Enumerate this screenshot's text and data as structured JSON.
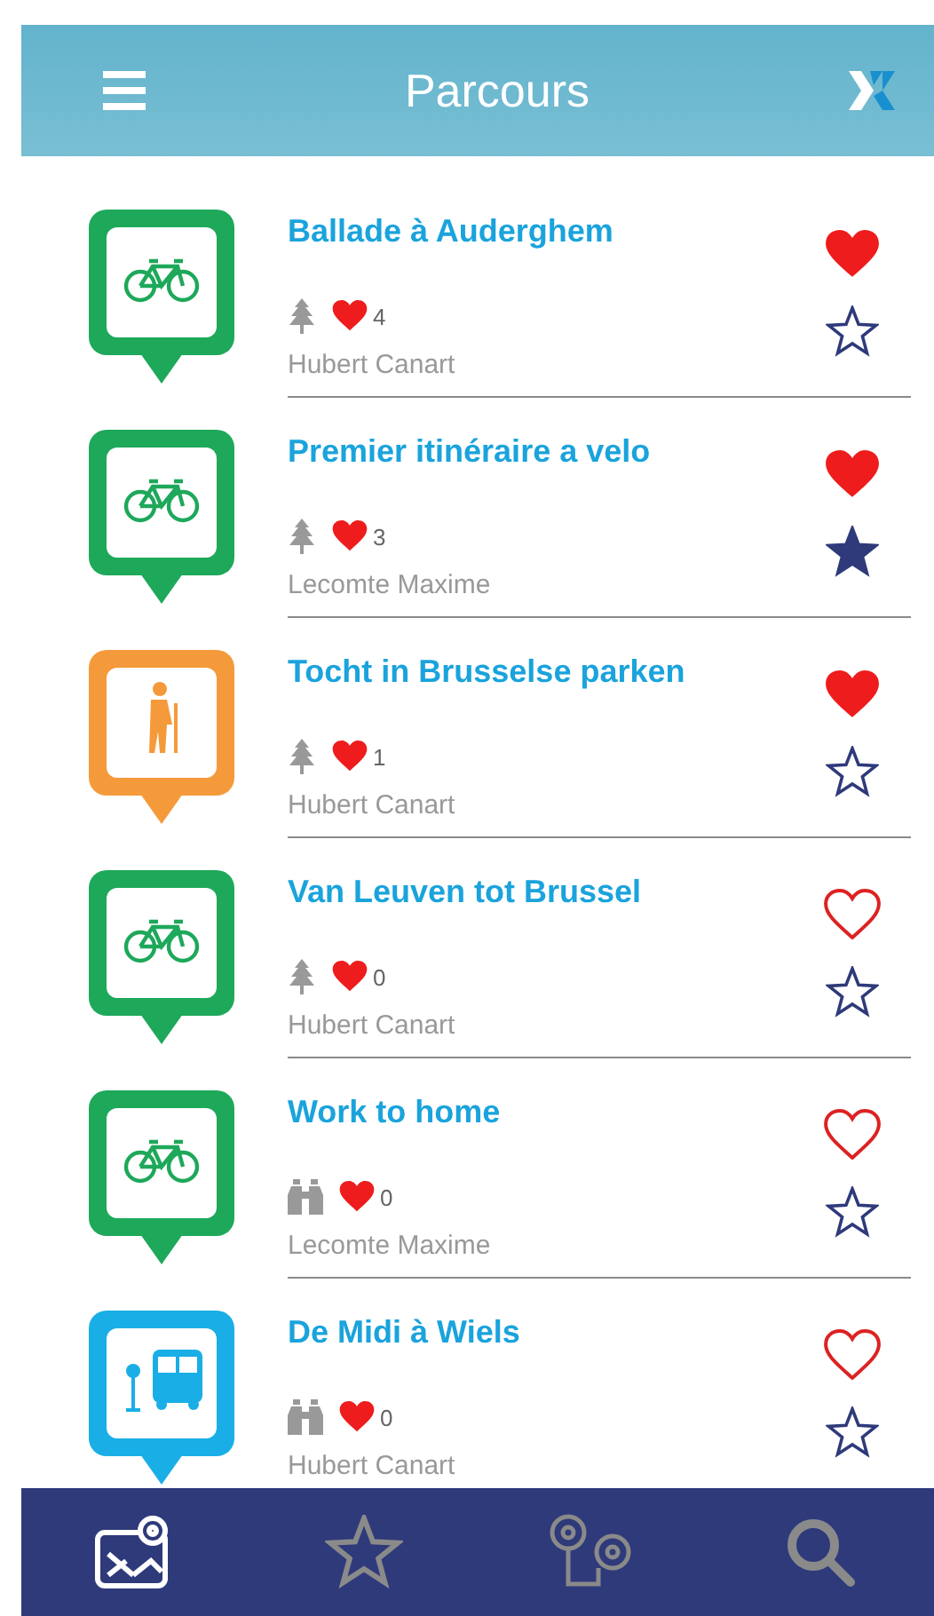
{
  "header": {
    "title": "Parcours"
  },
  "routes": [
    {
      "kind": "bike",
      "color": "#1ea85a",
      "title": "Ballade à Auderghem",
      "terrain": {
        "kind": "tree"
      },
      "likes": "4",
      "author": "Hubert Canart",
      "liked": true,
      "favorite": false
    },
    {
      "kind": "bike",
      "color": "#1ea85a",
      "title": "Premier itinéraire a velo",
      "terrain": {
        "kind": "tree"
      },
      "likes": "3",
      "author": "Lecomte Maxime",
      "liked": true,
      "favorite": true
    },
    {
      "kind": "hiker",
      "color": "#f59a3a",
      "title": "Tocht in Brusselse parken",
      "terrain": {
        "kind": "tree"
      },
      "likes": "1",
      "author": "Hubert Canart",
      "liked": true,
      "favorite": false
    },
    {
      "kind": "bike",
      "color": "#1ea85a",
      "title": "Van Leuven tot Brussel",
      "terrain": {
        "kind": "tree"
      },
      "likes": "0",
      "author": "Hubert Canart",
      "liked": false,
      "favorite": false
    },
    {
      "kind": "bike",
      "color": "#1ea85a",
      "title": "Work to home",
      "terrain": {
        "kind": "binoculars"
      },
      "likes": "0",
      "author": "Lecomte Maxime",
      "liked": false,
      "favorite": false
    },
    {
      "kind": "bus",
      "color": "#1aaee6",
      "title": "De Midi à Wiels",
      "terrain": {
        "kind": "binoculars"
      },
      "likes": "0",
      "author": "Hubert Canart",
      "liked": false,
      "favorite": false
    }
  ],
  "tabs": [
    {
      "kind": "map",
      "selected": true
    },
    {
      "kind": "favorites",
      "selected": false
    },
    {
      "kind": "route",
      "selected": false
    },
    {
      "kind": "search",
      "selected": false
    }
  ]
}
